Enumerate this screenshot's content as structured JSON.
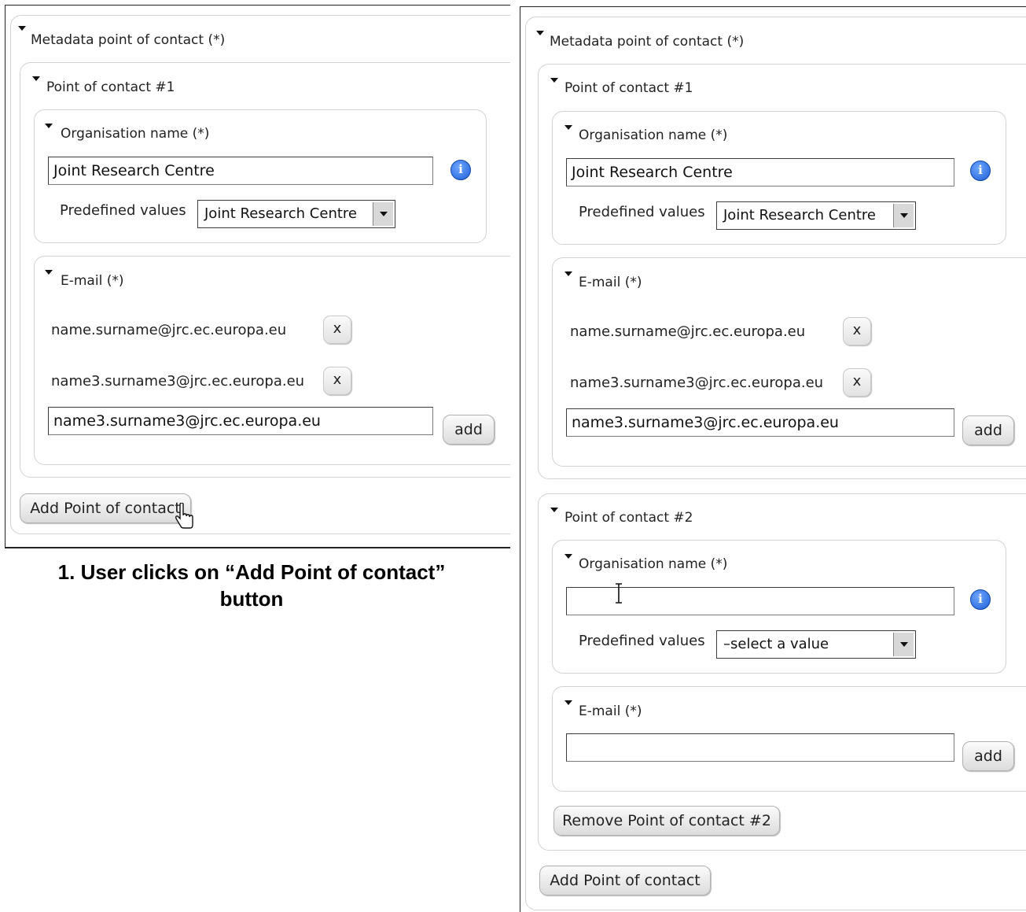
{
  "step1": {
    "section_title": "Metadata point of contact (*)",
    "contact_title": "Point of contact #1",
    "org": {
      "legend": "Organisation name (*)",
      "value": "Joint Research Centre",
      "predefined_label": "Predefined values",
      "predefined_selected": "Joint Research Centre"
    },
    "email": {
      "legend": "E-mail (*)",
      "entries": [
        "name.surname@jrc.ec.europa.eu",
        "name3.surname3@jrc.ec.europa.eu"
      ],
      "input_value": "name3.surname3@jrc.ec.europa.eu",
      "add_label": "add"
    },
    "remove_label": "x",
    "add_contact_label": "Add Point of contact"
  },
  "caption": {
    "line1": "1. User clicks on “Add Point of contact”",
    "line2": "button"
  },
  "step2": {
    "section_title": "Metadata point of contact (*)",
    "contact1": {
      "title": "Point of contact #1",
      "org": {
        "legend": "Organisation name (*)",
        "value": "Joint Research Centre",
        "predefined_label": "Predefined values",
        "predefined_selected": "Joint Research Centre"
      },
      "email": {
        "legend": "E-mail (*)",
        "entries": [
          "name.surname@jrc.ec.europa.eu",
          "name3.surname3@jrc.ec.europa.eu"
        ],
        "input_value": "name3.surname3@jrc.ec.europa.eu",
        "add_label": "add"
      }
    },
    "contact2": {
      "title": "Point of contact #2",
      "org": {
        "legend": "Organisation name (*)",
        "value": "",
        "predefined_label": "Predefined values",
        "predefined_selected": "–select a value"
      },
      "email": {
        "legend": "E-mail (*)",
        "input_value": "",
        "add_label": "add"
      },
      "remove_contact_label": "Remove Point of contact #2"
    },
    "remove_label": "x",
    "add_contact_label": "Add Point of contact"
  },
  "icons": {
    "info": "info-icon",
    "collapse": "collapse-triangle-icon",
    "cursor": "hand-pointer-icon",
    "text_cursor": "text-cursor-icon",
    "select_arrow": "dropdown-arrow-icon"
  },
  "colors": {
    "info_blue": "#1f5fd6",
    "border": "#d2d2d2"
  }
}
